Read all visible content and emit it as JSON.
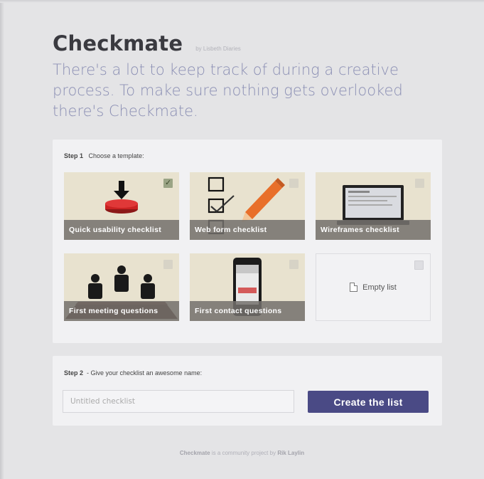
{
  "header": {
    "title": "Checkmate",
    "by_line": "by Lisbeth Diaries",
    "intro": "There's a lot to keep track of during a creative process. To make sure nothing gets overlooked there's Checkmate."
  },
  "step1": {
    "step": "Step 1",
    "label": "Choose a template:",
    "templates": [
      {
        "label": "Quick usability checklist",
        "selected": true
      },
      {
        "label": "Web form checklist",
        "selected": false
      },
      {
        "label": "Wireframes checklist",
        "selected": false
      },
      {
        "label": "First meeting questions",
        "selected": false
      },
      {
        "label": "First contact questions",
        "selected": false
      },
      {
        "label": "Empty list",
        "selected": false
      }
    ]
  },
  "step2": {
    "step": "Step 2",
    "label": "- Give your checklist an awesome name:",
    "name_placeholder": "Untitled checklist",
    "name_value": "",
    "create_label": "Create the list"
  },
  "footer": {
    "brand": "Checkmate",
    "text": "is a community project by",
    "author": "Rik Laylin"
  },
  "colors": {
    "accent": "#4a4a85",
    "intro_text": "#8b8fb4",
    "tile_bg": "#e8e2cf",
    "check_selected": "#9aa485"
  },
  "icons": {
    "arrow": "arrow-down-icon",
    "button": "red-button-icon",
    "form": "checkbox-form-icon",
    "pencil": "pencil-icon",
    "laptop": "laptop-icon",
    "people": "meeting-people-icon",
    "phone": "phone-icon",
    "document": "document-icon"
  }
}
